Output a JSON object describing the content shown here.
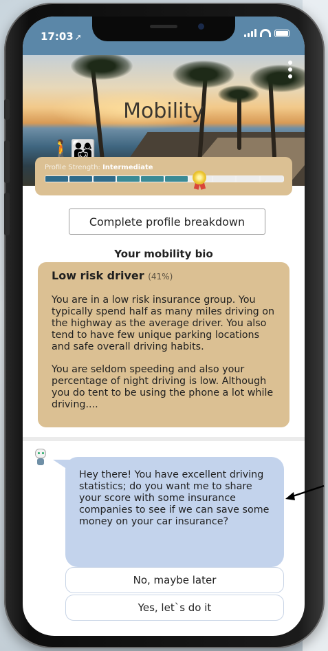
{
  "status_bar": {
    "time": "17:03",
    "time_arrow": "➚"
  },
  "hero": {
    "title": "Mobility"
  },
  "profile_strength": {
    "label": "Profile Strength: ",
    "level": "Intermediate",
    "progress_percent": 60,
    "segments_total": 10,
    "segments_filled": 6
  },
  "breakdown_button": {
    "label": "Complete profile breakdown"
  },
  "bio": {
    "section_title": "Your mobility bio",
    "heading": "Low risk driver",
    "percent": "(41%)",
    "paragraph_1": "You are in a low risk insurance group. You typically spend half as many miles driving on the highway as the average driver. You also tend to have few unique parking locations and safe overall driving habits.",
    "paragraph_2": "You are seldom speeding and also your percentage of night driving is low. Although you do tent to be using the phone a lot while driving...."
  },
  "chat": {
    "message": "Hey there! You have excellent driving statistics; do you want me to share your score with some insurance companies to see if we can save some money on your car insurance?",
    "replies": [
      {
        "label": "No, maybe later"
      },
      {
        "label": "Yes, let`s do it"
      }
    ]
  },
  "colors": {
    "status_bar": "#5b87a8",
    "panel_tan": "#dbc093",
    "chat_bubble": "#c3d3ec",
    "progress_fill": "#2f6b8a"
  }
}
